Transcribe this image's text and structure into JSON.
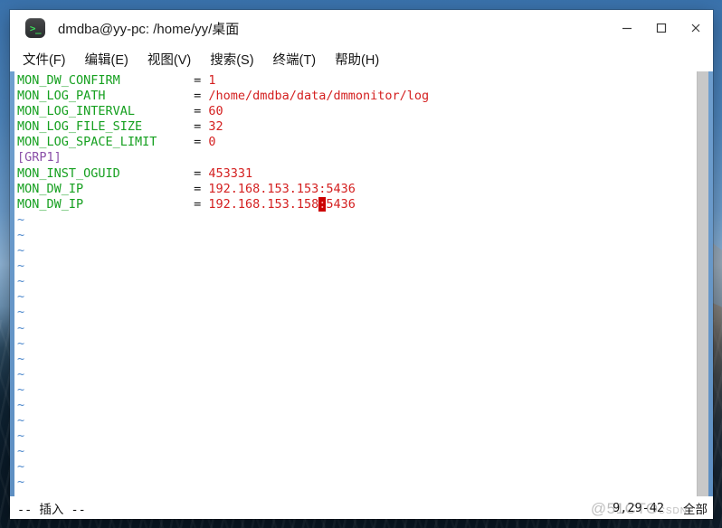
{
  "window": {
    "title": "dmdba@yy-pc: /home/yy/桌面",
    "icon": "terminal-icon",
    "controls": {
      "minimize": "–",
      "maximize": "□",
      "close": "✕"
    }
  },
  "menubar": {
    "items": [
      {
        "label": "文件(F)",
        "name": "menu-file"
      },
      {
        "label": "编辑(E)",
        "name": "menu-edit"
      },
      {
        "label": "视图(V)",
        "name": "menu-view"
      },
      {
        "label": "搜索(S)",
        "name": "menu-search"
      },
      {
        "label": "终端(T)",
        "name": "menu-terminal"
      },
      {
        "label": "帮助(H)",
        "name": "menu-help"
      }
    ]
  },
  "editor": {
    "lines": [
      {
        "type": "kv",
        "key": "MON_DW_CONFIRM",
        "eq": "=",
        "value": "1"
      },
      {
        "type": "kv",
        "key": "MON_LOG_PATH",
        "eq": "=",
        "value": "/home/dmdba/data/dmmonitor/log"
      },
      {
        "type": "kv",
        "key": "MON_LOG_INTERVAL",
        "eq": "=",
        "value": "60"
      },
      {
        "type": "kv",
        "key": "MON_LOG_FILE_SIZE",
        "eq": "=",
        "value": "32"
      },
      {
        "type": "kv",
        "key": "MON_LOG_SPACE_LIMIT",
        "eq": "=",
        "value": "0"
      },
      {
        "type": "section",
        "text": "[GRP1]"
      },
      {
        "type": "kv",
        "key": "MON_INST_OGUID",
        "eq": "=",
        "value": "453331"
      },
      {
        "type": "kv",
        "key": "MON_DW_IP",
        "eq": "=",
        "value": "192.168.153.153:5436"
      },
      {
        "type": "kv-cursor",
        "key": "MON_DW_IP",
        "eq": "=",
        "value_before": "192.168.153.158",
        "cursor_char": ":",
        "value_after": "5436"
      }
    ],
    "empty_marker": "~",
    "empty_line_count": 19,
    "key_column_width": 24
  },
  "statusbar": {
    "mode": "-- 插入 --",
    "position": "9,29-42",
    "scroll_indicator": "全部"
  },
  "watermark": {
    "text": "@51CTO",
    "sub": "CSDN"
  },
  "colors": {
    "key": "#16a020",
    "value": "#d42020",
    "section": "#8a4fa8",
    "tilde": "#4d88cc",
    "cursor_bg": "#cc0000",
    "window_edge": "#6f9fcf",
    "desktop": "#2f6aa8"
  }
}
